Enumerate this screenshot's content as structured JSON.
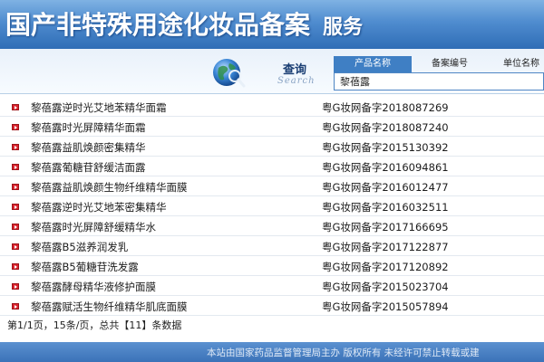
{
  "header": {
    "title": "国产非特殊用途化妆品备案",
    "title_suffix": "服务"
  },
  "search": {
    "label_zh": "查询",
    "label_en": "Search",
    "tabs": [
      {
        "label": "产品名称",
        "active": true
      },
      {
        "label": "备案编号",
        "active": false
      },
      {
        "label": "单位名称",
        "active": false
      }
    ],
    "input_value": "黎蓓露"
  },
  "results": [
    {
      "name": "黎蓓露逆时光艾地苯精华面霜",
      "code": "粤G妆网备字2018087269"
    },
    {
      "name": "黎蓓露时光屏障精华面霜",
      "code": "粤G妆网备字2018087240"
    },
    {
      "name": "黎蓓露益肌焕颜密集精华",
      "code": "粤G妆网备字2015130392"
    },
    {
      "name": "黎蓓露葡糖苷舒缓洁面露",
      "code": "粤G妆网备字2016094861"
    },
    {
      "name": "黎蓓露益肌焕颜生物纤维精华面膜",
      "code": "粤G妆网备字2016012477"
    },
    {
      "name": "黎蓓露逆时光艾地苯密集精华",
      "code": "粤G妆网备字2016032511"
    },
    {
      "name": "黎蓓露时光屏障舒缓精华水",
      "code": "粤G妆网备字2017166695"
    },
    {
      "name": "黎蓓露B5滋养润发乳",
      "code": "粤G妆网备字2017122877"
    },
    {
      "name": "黎蓓露B5葡糖苷洗发露",
      "code": "粤G妆网备字2017120892"
    },
    {
      "name": "黎蓓露酵母精华液修护面膜",
      "code": "粤G妆网备字2015023704"
    },
    {
      "name": "黎蓓露赋活生物纤维精华肌底面膜",
      "code": "粤G妆网备字2015057894"
    }
  ],
  "pager": {
    "text": "第1/1页，15条/页，总共【11】条数据"
  },
  "footer": {
    "text": "本站由国家药品监督管理局主办 版权所有 未经许可禁止转载或建"
  },
  "colors": {
    "banner": "#4f8ccf",
    "accent": "#3f7fc4",
    "bullet": "#d9232d"
  }
}
